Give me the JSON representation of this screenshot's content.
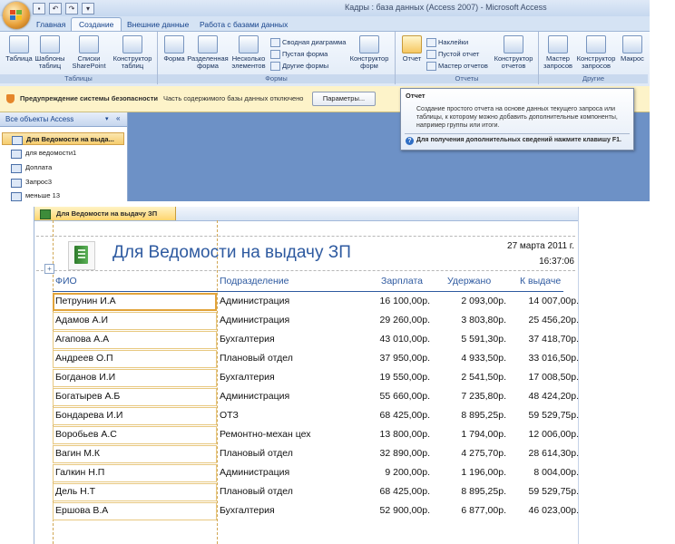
{
  "window": {
    "title": "Кадры : база данных (Access 2007) - Microsoft Access"
  },
  "ribbon_tabs": [
    "Главная",
    "Создание",
    "Внешние данные",
    "Работа с базами данных"
  ],
  "ribbon": {
    "groups": [
      "Таблицы",
      "Формы",
      "Отчеты",
      "Другие"
    ],
    "tables": {
      "table": "Таблица",
      "templates": "Шаблоны таблиц",
      "sharepoint": "Списки SharePoint",
      "constructor": "Конструктор таблиц"
    },
    "forms": {
      "form": "Форма",
      "split": "Разделенная форма",
      "multiple": "Несколько элементов",
      "pivot_chart": "Сводная диаграмма",
      "blank_form": "Пустая форма",
      "other_forms": "Другие формы",
      "form_designer": "Конструктор форм"
    },
    "reports": {
      "report": "Отчет",
      "labels": "Наклейки",
      "blank_report": "Пустой отчет",
      "report_wizard": "Мастер отчетов",
      "report_designer": "Конструктор отчетов"
    },
    "other": {
      "query_wizard": "Мастер запросов",
      "query_designer": "Конструктор запросов",
      "macro": "Макрос"
    }
  },
  "security_bar": {
    "title": "Предупреждение системы безопасности",
    "text": "Часть содержимого базы данных отключено",
    "button": "Параметры..."
  },
  "tooltip": {
    "title": "Отчет",
    "body": "Создание простого отчета на основе данных текущего запроса или таблицы, к которому можно добавить дополнительные компоненты, например группы или итоги.",
    "help": "Для получения дополнительных сведений нажмите клавишу F1."
  },
  "nav_pane": {
    "header": "Все объекты Access",
    "items": [
      "Для Ведомости на выда...",
      "для ведомости1",
      "Доплата",
      "Запрос3",
      "меньше 13"
    ]
  },
  "report": {
    "tab": "Для Ведомости на выдачу ЗП",
    "title": "Для Ведомости на выдачу ЗП",
    "date": "27 марта 2011 г.",
    "time": "16:37:06",
    "columns": [
      "ФИО",
      "Подразделение",
      "Зарплата",
      "Удержано",
      "К выдаче"
    ],
    "rows": [
      [
        "Петрунин И.А",
        "Администрация",
        "16 100,00р.",
        "2 093,00р.",
        "14 007,00р."
      ],
      [
        "Адамов А.И",
        "Администрация",
        "29 260,00р.",
        "3 803,80р.",
        "25 456,20р."
      ],
      [
        "Агапова А.А",
        "Бухгалтерия",
        "43 010,00р.",
        "5 591,30р.",
        "37 418,70р."
      ],
      [
        "Андреев О.П",
        "Плановый отдел",
        "37 950,00р.",
        "4 933,50р.",
        "33 016,50р."
      ],
      [
        "Богданов И.И",
        "Бухгалтерия",
        "19 550,00р.",
        "2 541,50р.",
        "17 008,50р."
      ],
      [
        "Богатырев А.Б",
        "Администрация",
        "55 660,00р.",
        "7 235,80р.",
        "48 424,20р."
      ],
      [
        "Бондарева И.И",
        "ОТЗ",
        "68 425,00р.",
        "8 895,25р.",
        "59 529,75р."
      ],
      [
        "Воробьев А.С",
        "Ремонтно-механ цех",
        "13 800,00р.",
        "1 794,00р.",
        "12 006,00р."
      ],
      [
        "Вагин М.К",
        "Плановый отдел",
        "32 890,00р.",
        "4 275,70р.",
        "28 614,30р."
      ],
      [
        "Галкин Н.П",
        "Администрация",
        "9 200,00р.",
        "1 196,00р.",
        "8 004,00р."
      ],
      [
        "Дель Н.Т",
        "Плановый отдел",
        "68 425,00р.",
        "8 895,25р.",
        "59 529,75р."
      ],
      [
        "Ершова В.А",
        "Бухгалтерия",
        "52 900,00р.",
        "6 877,00р.",
        "46 023,00р."
      ]
    ]
  }
}
